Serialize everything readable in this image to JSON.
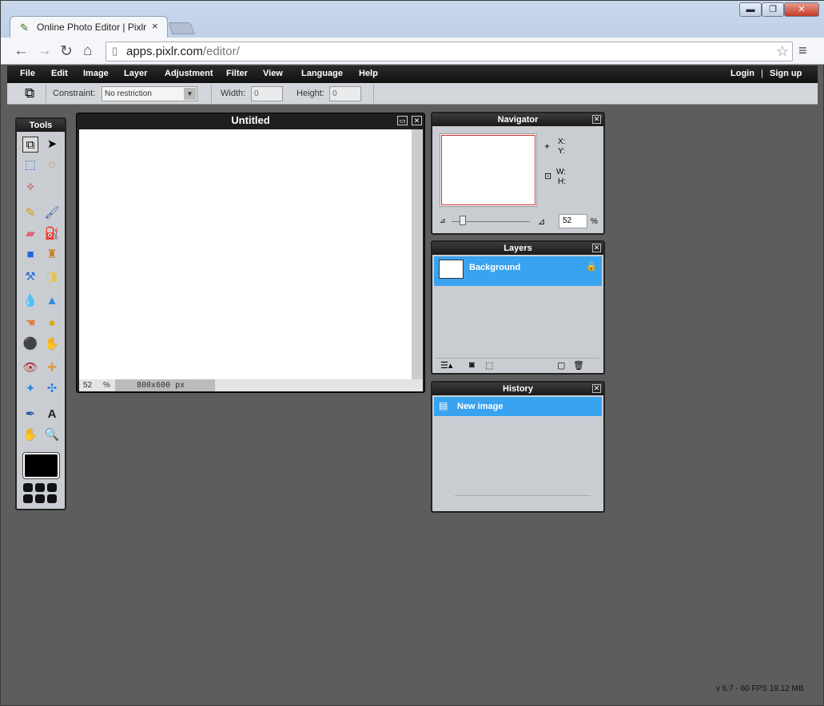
{
  "browser": {
    "tab_title": "Online Photo Editor | Pixlr",
    "tab_close": "×",
    "url_host": "apps.pixlr.com",
    "url_path": "/editor/",
    "win_min": "▬",
    "win_max": "❐",
    "win_close": "✕"
  },
  "menu": {
    "items": [
      "File",
      "Edit",
      "Image",
      "Layer",
      "Adjustment",
      "Filter",
      "View",
      "Language",
      "Help"
    ],
    "login": "Login",
    "divider": "|",
    "signup": "Sign up"
  },
  "options": {
    "constraint_label": "Constraint:",
    "constraint_value": "No restriction",
    "width_label": "Width:",
    "width_value": "0",
    "height_label": "Height:",
    "height_value": "0"
  },
  "tools": {
    "title": "Tools"
  },
  "canvas": {
    "title": "Untitled",
    "zoom": "52",
    "zoom_unit": "%",
    "size": "800x600 px"
  },
  "navigator": {
    "title": "Navigator",
    "x_label": "X:",
    "y_label": "Y:",
    "w_label": "W:",
    "h_label": "H:",
    "zoom_value": "52",
    "zoom_unit": "%"
  },
  "layers": {
    "title": "Layers",
    "items": [
      "Background"
    ]
  },
  "history": {
    "title": "History",
    "items": [
      "New image"
    ]
  },
  "footer": {
    "status": "v 6.7 - 60 FPS 19.12 MB"
  },
  "colors": {
    "accent": "#3aa3f0",
    "panel": "#c9cdd2",
    "workspace": "#5d5d5d"
  }
}
